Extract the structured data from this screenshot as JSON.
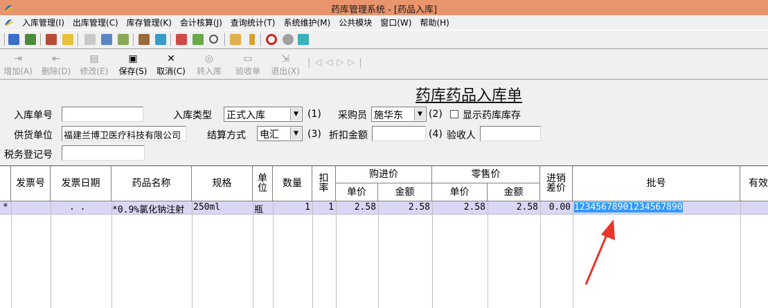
{
  "window": {
    "title": "药库管理系统 - [药品入库]"
  },
  "menu": [
    "入库管理(I)",
    "出库管理(C)",
    "库存管理(K)",
    "会计核算(J)",
    "查询统计(T)",
    "系统维护(M)",
    "公共模块",
    "窗口(W)",
    "帮助(H)"
  ],
  "toolbar": {
    "add": "增加(A)",
    "delete": "删除(D)",
    "edit": "修改(E)",
    "save": "保存(S)",
    "cancel": "取消(C)",
    "transfer": "转入库",
    "receipt": "验收单",
    "exit": "退出(X)"
  },
  "form": {
    "doc_title": "药库药品入库单",
    "entry_no_label": "入库单号",
    "entry_no_value": "",
    "entry_type_label": "入库类型",
    "entry_type_value": "正式入库",
    "hint1": "(1)",
    "buyer_label": "采购员",
    "buyer_value": "施华东",
    "hint2": "(2)",
    "show_stock_label": "显示药库库存",
    "supplier_label": "供货单位",
    "supplier_value": "福建兰博卫医疗科技有限公司",
    "settle_label": "结算方式",
    "settle_value": "电汇",
    "hint3": "(3)",
    "discount_label": "折扣金额",
    "discount_value": "",
    "hint4": "(4)",
    "inspector_label": "验收人",
    "inspector_value": "",
    "tax_label": "税务登记号",
    "tax_value": ""
  },
  "grid": {
    "headers": {
      "invoice_no": "发票号",
      "invoice_date": "发票日期",
      "drug_name": "药品名称",
      "spec": "规格",
      "unit_a": "单",
      "unit_b": "位",
      "qty": "数量",
      "rate_a": "扣",
      "rate_b": "率",
      "purchase": "购进价",
      "retail": "零售价",
      "unit_price": "单价",
      "amount": "金额",
      "diff_a": "进销",
      "diff_b": "差价",
      "batch": "批号",
      "expiry": "有效"
    },
    "rows": [
      {
        "marker": "*",
        "invoice_no": "",
        "invoice_date": ". .",
        "drug_name": "*0.9%氯化钠注射",
        "spec": "250ml",
        "unit": "瓶",
        "qty": "1",
        "rate": "1",
        "purchase_price": "2.58",
        "purchase_amount": "2.58",
        "retail_price": "2.58",
        "retail_amount": "2.58",
        "diff": "0.00",
        "batch": "12345678901234567890"
      }
    ]
  },
  "colors": {
    "titlebar": "#e8956e",
    "row_highlight": "#d8d8f4",
    "selection": "#3399ff",
    "annotation_arrow": "#e8352a"
  }
}
